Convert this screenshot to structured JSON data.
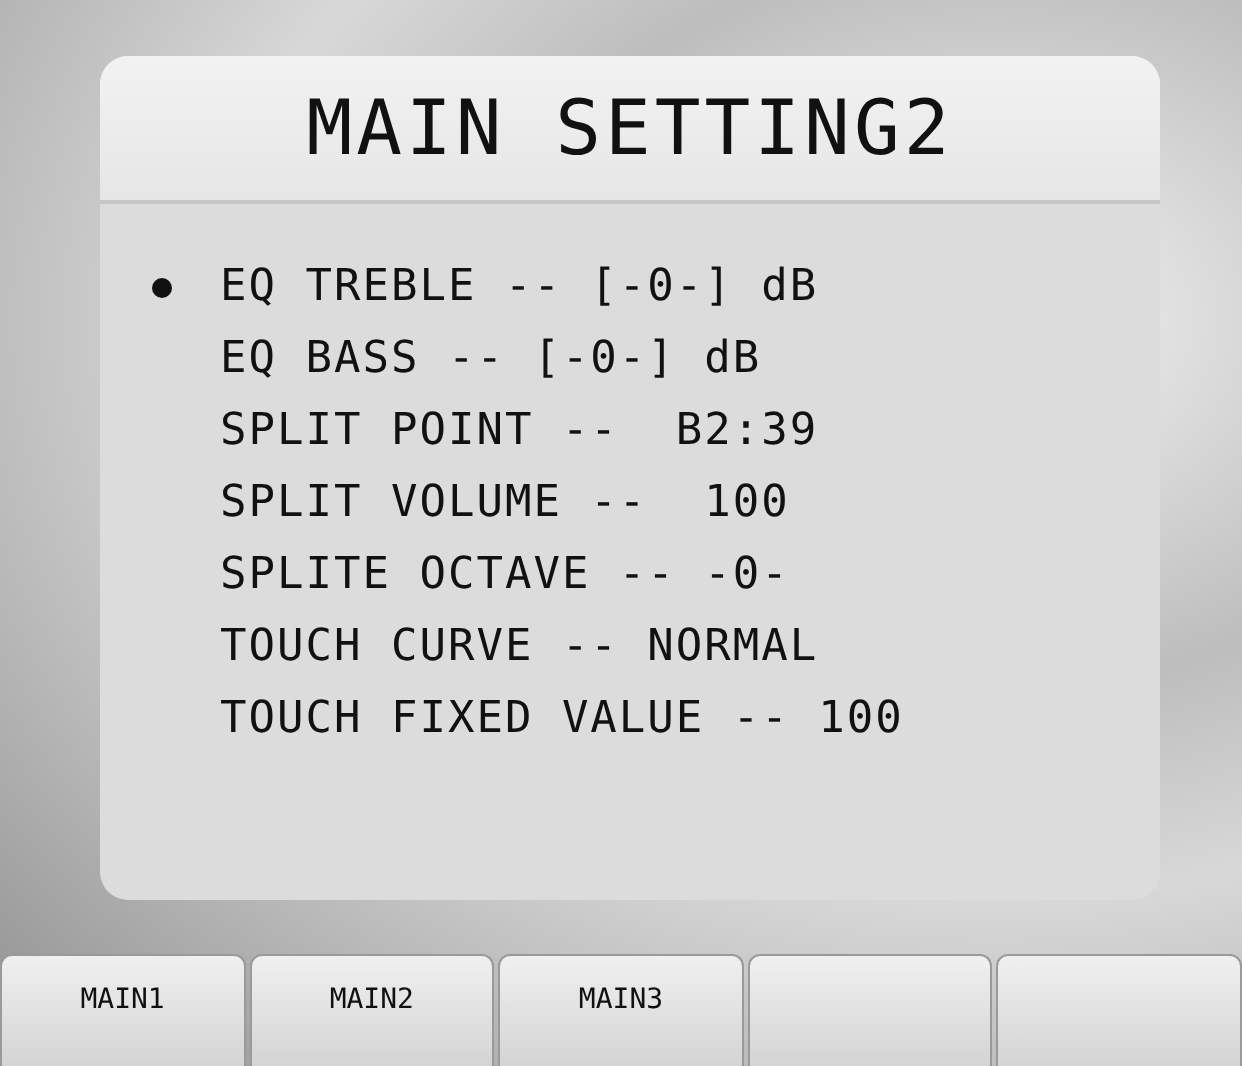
{
  "title": "MAIN SETTING2",
  "items": [
    {
      "label": "EQ TREBLE -- [-0-] dB",
      "selected": true
    },
    {
      "label": "EQ BASS -- [-0-] dB",
      "selected": false
    },
    {
      "label": "SPLIT POINT --  B2:39",
      "selected": false
    },
    {
      "label": "SPLIT VOLUME --  100",
      "selected": false
    },
    {
      "label": "SPLITE OCTAVE -- -0-",
      "selected": false
    },
    {
      "label": "TOUCH CURVE -- NORMAL",
      "selected": false
    },
    {
      "label": "TOUCH FIXED VALUE -- 100",
      "selected": false
    }
  ],
  "tabs": [
    {
      "label": "MAIN1"
    },
    {
      "label": "MAIN2"
    },
    {
      "label": "MAIN3"
    }
  ]
}
